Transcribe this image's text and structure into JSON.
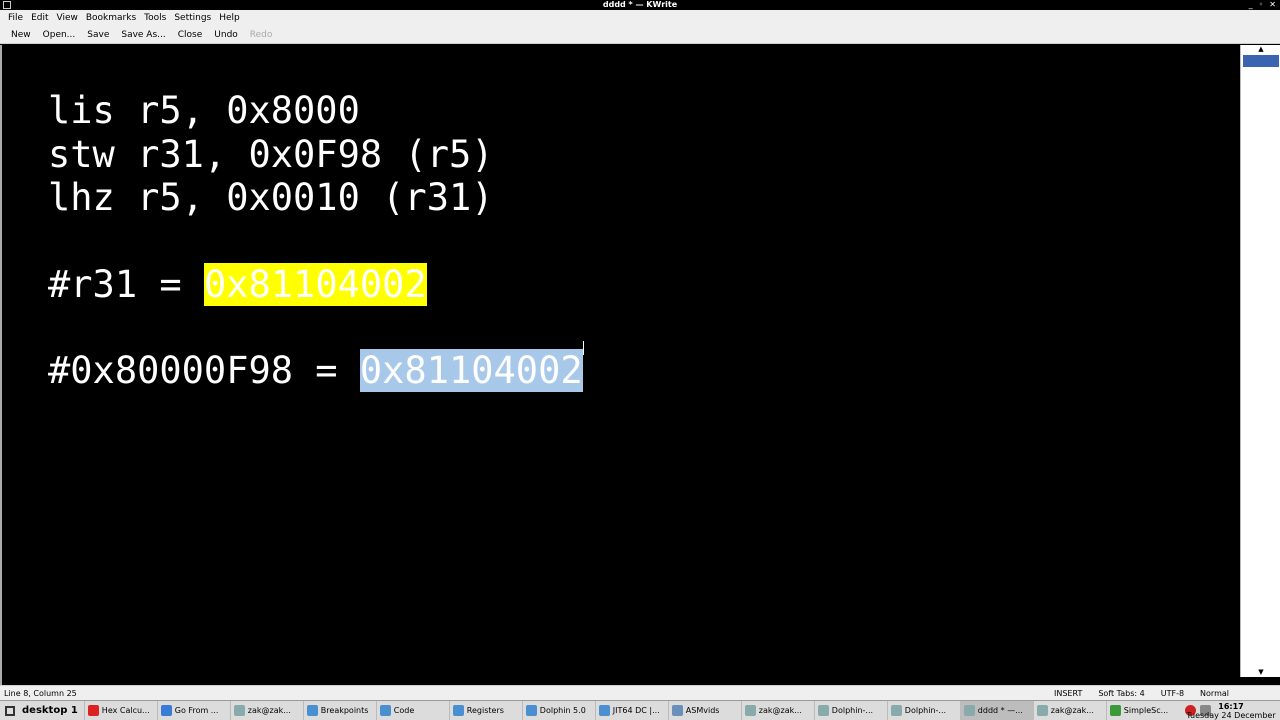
{
  "window": {
    "title": "dddd * — KWrite"
  },
  "menu": {
    "items": [
      "File",
      "Edit",
      "View",
      "Bookmarks",
      "Tools",
      "Settings",
      "Help"
    ]
  },
  "toolbar": {
    "new": "New",
    "open": "Open...",
    "save": "Save",
    "save_as": "Save As...",
    "close": "Close",
    "undo": "Undo",
    "redo": "Redo"
  },
  "editor": {
    "lines": [
      "lis r5, 0x8000",
      "stw r31, 0x0F98 (r5)",
      "lhz r5, 0x0010 (r31)"
    ],
    "r31_label": "#r31 = ",
    "r31_value": "0x81104002",
    "mem_label": "#0x80000F98 = ",
    "mem_value": "0x81104002"
  },
  "status": {
    "position": "Line 8, Column 25",
    "mode": "INSERT",
    "tabs": "Soft Tabs: 4",
    "encoding": "UTF-8",
    "highlight": "Normal"
  },
  "taskbar": {
    "desktop": "desktop 1",
    "tasks": [
      {
        "label": "Hex Calcu...",
        "color": "#d22"
      },
      {
        "label": "Go From ...",
        "color": "#3a7bd5"
      },
      {
        "label": "zak@zak...",
        "color": "#8aa"
      },
      {
        "label": "Breakpoints",
        "color": "#4a8fd0"
      },
      {
        "label": "Code",
        "color": "#4a8fd0"
      },
      {
        "label": "Registers",
        "color": "#4a8fd0"
      },
      {
        "label": "Dolphin 5.0",
        "color": "#4a8fd0"
      },
      {
        "label": "JIT64 DC |...",
        "color": "#4a8fd0"
      },
      {
        "label": "ASMvids",
        "color": "#6a8fb8"
      },
      {
        "label": "zak@zak...",
        "color": "#8aa"
      },
      {
        "label": "Dolphin-...",
        "color": "#8aa"
      },
      {
        "label": "Dolphin-...",
        "color": "#8aa"
      },
      {
        "label": "dddd * —...",
        "color": "#8aa"
      },
      {
        "label": "zak@zak...",
        "color": "#8aa"
      },
      {
        "label": "SimpleSc...",
        "color": "#3a9a3a"
      }
    ],
    "time": "16:17",
    "date": "Tuesday 24 December"
  },
  "colors": {
    "highlight_yellow": "#ffff00",
    "selection_blue": "#a8c8ea",
    "editor_bg": "#000000"
  }
}
